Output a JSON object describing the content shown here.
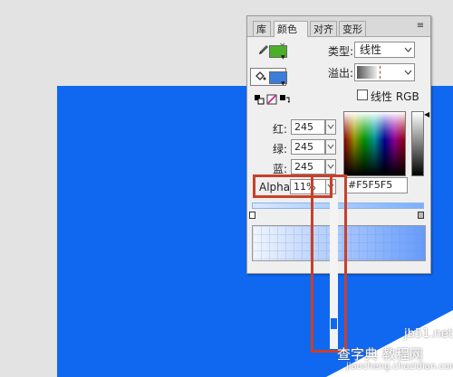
{
  "tabs": {
    "library": "库",
    "color": "颜色",
    "color_close": "×",
    "align": "对齐",
    "transform": "变形"
  },
  "panel_menu_icon": "≡",
  "stroke_color": "#4caf2a",
  "fill_color": "#3c7ddb",
  "type_label": "类型:",
  "type_value": "线性",
  "overflow_label": "溢出:",
  "linear_rgb_label": "线性 RGB",
  "rgb": {
    "r_label": "红:",
    "r_value": "245",
    "g_label": "绿:",
    "g_value": "245",
    "b_label": "蓝:",
    "b_value": "245"
  },
  "alpha_label": "Alpha:",
  "alpha_value": "11%",
  "hex_value": "#F5F5F5",
  "watermark": {
    "site1": "jb51.net",
    "site2": "查字典 教程网",
    "site3": "jiaocheng.chazidian.com"
  },
  "icons": [
    "pencil-icon",
    "paint-bucket-icon",
    "swap-colors-icon",
    "no-color-icon",
    "default-colors-icon",
    "chevron-down-icon"
  ]
}
